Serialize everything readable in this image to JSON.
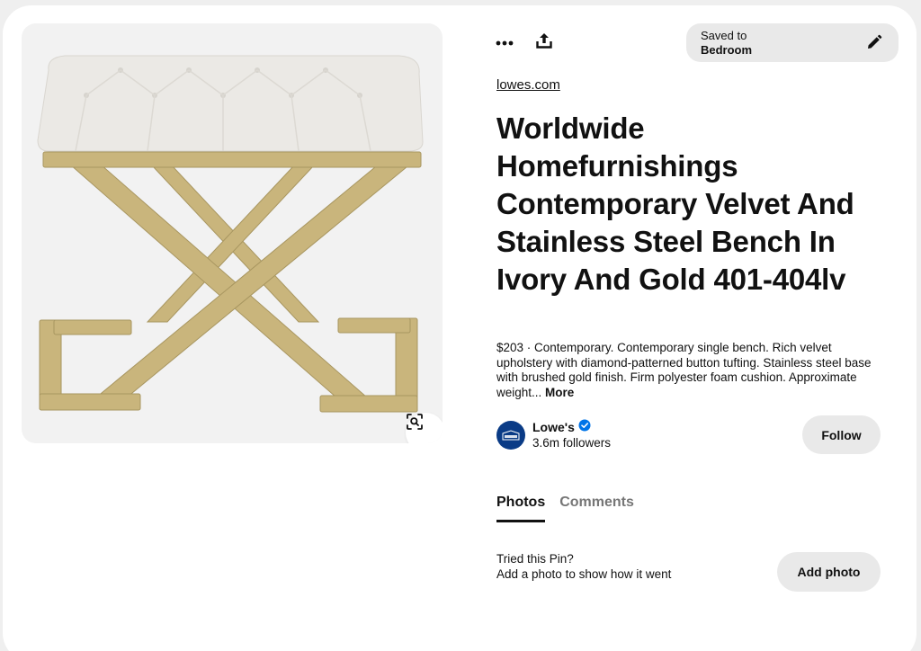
{
  "pin": {
    "source": "lowes.com",
    "title": "Worldwide Homefurnishings Contemporary Velvet And Stainless Steel Bench In Ivory And Gold 401-404lv",
    "description": "$203 · Contemporary. Contemporary single bench. Rich velvet upholstery with diamond-patterned button tufting. Stainless steel base with brushed gold finish. Firm polyester foam cushion. Approximate weight...",
    "more_label": "More"
  },
  "saved": {
    "label": "Saved to",
    "board": "Bedroom"
  },
  "creator": {
    "name": "Lowe's",
    "followers": "3.6m followers",
    "verified": true,
    "follow_label": "Follow"
  },
  "tabs": [
    {
      "label": "Photos",
      "active": true
    },
    {
      "label": "Comments",
      "active": false
    }
  ],
  "tried": {
    "question": "Tried this Pin?",
    "prompt": "Add a photo to show how it went",
    "button_label": "Add photo"
  },
  "icons": {
    "more": "ellipsis-icon",
    "share": "share-upload-icon",
    "edit": "pencil-icon",
    "visual_search": "visual-search-icon",
    "verified": "verified-badge-icon"
  },
  "colors": {
    "text": "#111111",
    "muted": "#767676",
    "pill": "#e9e9e9",
    "verified": "#0074e8",
    "avatar": "#0a3b86"
  }
}
